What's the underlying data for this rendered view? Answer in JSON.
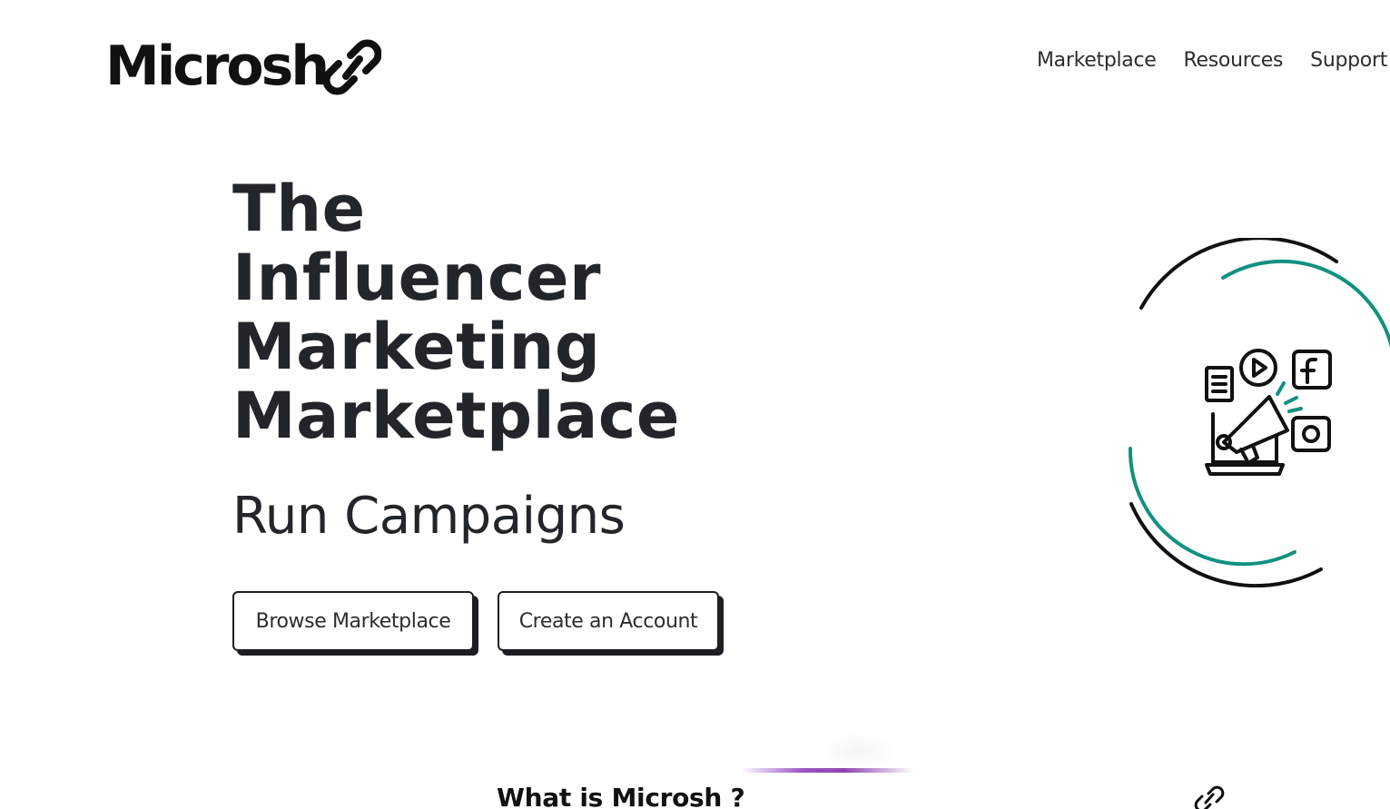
{
  "header": {
    "logo_text": "Microsh",
    "logo_icon": "chain-link-icon",
    "nav": [
      {
        "label": "Marketplace"
      },
      {
        "label": "Resources"
      },
      {
        "label": "Support"
      }
    ]
  },
  "hero": {
    "title_lines": [
      "The",
      "Influencer",
      "Marketing",
      "Marketplace"
    ],
    "subtitle": "Run Campaigns",
    "buttons": {
      "browse": "Browse Marketplace",
      "create": "Create an Account"
    },
    "illustration_icon": "megaphone-laptop-social-icon"
  },
  "about": {
    "heading": "What is Microsh ?"
  },
  "colors": {
    "text": "#22262a",
    "accent_teal": "#12917f",
    "divider_purple": "#8e44ad",
    "button_shadow": "#1b1f24"
  }
}
